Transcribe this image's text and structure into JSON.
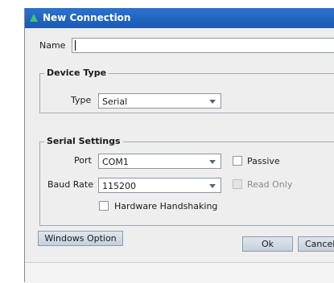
{
  "window": {
    "title": "New Connection",
    "icon": "triangle-app-icon"
  },
  "name_field": {
    "label": "Name",
    "value": ""
  },
  "device_type": {
    "legend": "Device Type",
    "type_label": "Type",
    "type_value": "Serial"
  },
  "serial_settings": {
    "legend": "Serial Settings",
    "port_label": "Port",
    "port_value": "COM1",
    "passive_label": "Passive",
    "baud_label": "Baud Rate",
    "baud_value": "115200",
    "readonly_label": "Read Only",
    "handshake_label": "Hardware Handshaking"
  },
  "buttons": {
    "windows_option": "Windows Option",
    "ok": "Ok",
    "cancel": "Cancel"
  }
}
